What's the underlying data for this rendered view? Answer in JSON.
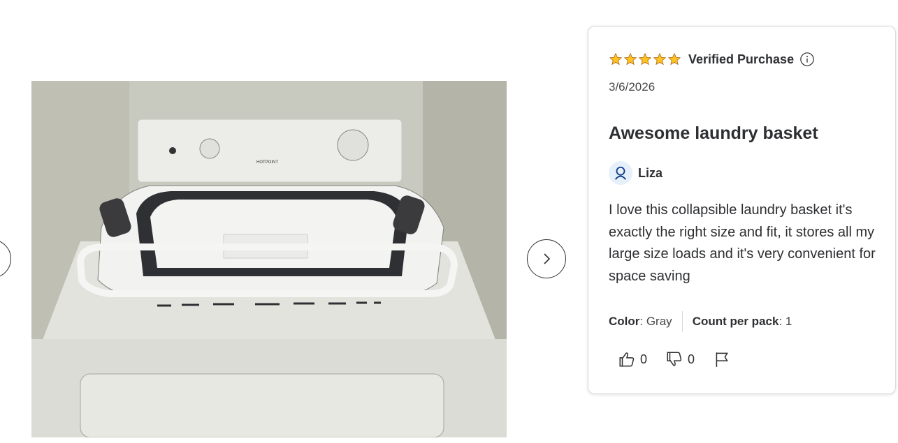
{
  "gallery": {
    "photo_alt": "White collapsible laundry basket on top of a washing machine",
    "washer_brand": "HOTPOINT",
    "prev_icon": "chevron-left-icon",
    "next_icon": "chevron-right-icon"
  },
  "review": {
    "rating": 5,
    "max_rating": 5,
    "star_color": "#ffc220",
    "verified_label": "Verified Purchase",
    "date": "3/6/2026",
    "title": "Awesome laundry basket",
    "author": "Liza",
    "body": "I love this collapsible laundry basket it's exactly the right size and fit, it stores all my large size loads and it's very convenient for space saving",
    "attributes": [
      {
        "name": "Color",
        "value": ": Gray"
      },
      {
        "name": "Count per pack",
        "value": ": 1"
      }
    ],
    "helpful_count": "0",
    "unhelpful_count": "0"
  }
}
